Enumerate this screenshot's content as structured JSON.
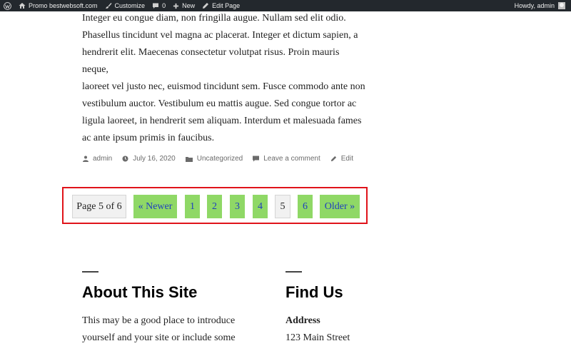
{
  "adminbar": {
    "site_name": "Promo bestwebsoft.com",
    "customize": "Customize",
    "comments_count": "0",
    "new_label": "New",
    "edit_page": "Edit Page",
    "howdy": "Howdy, admin",
    "icons": [
      "wordpress-icon",
      "home-icon",
      "brush-icon",
      "comment-icon",
      "plus-icon",
      "pencil-icon",
      "avatar"
    ]
  },
  "article": {
    "lines": [
      "Integer eu congue diam, non fringilla augue. Nullam sed elit odio.",
      "Phasellus tincidunt vel magna ac placerat. Integer et dictum sapien, a",
      "hendrerit elit. Maecenas consectetur volutpat risus. Proin mauris neque,",
      "laoreet vel justo nec, euismod tincidunt sem. Fusce commodo ante non",
      "vestibulum auctor. Vestibulum eu mattis augue. Sed congue tortor ac",
      "ligula laoreet, in hendrerit sem aliquam. Interdum et malesuada fames",
      "ac ante ipsum primis in faucibus."
    ]
  },
  "meta": {
    "author": "admin",
    "date": "July 16, 2020",
    "category": "Uncategorized",
    "comment": "Leave a comment",
    "edit": "Edit"
  },
  "pagination": {
    "page_of": "Page 5 of 6",
    "newer": "« Newer",
    "p1": "1",
    "p2": "2",
    "p3": "3",
    "p4": "4",
    "current": "5",
    "p6": "6",
    "older": "Older »"
  },
  "footer": {
    "about_title": "About This Site",
    "about_lines": [
      "This may be a good place to introduce",
      "yourself and your site or include some"
    ],
    "find_title": "Find Us",
    "address_label": "Address",
    "address_line1": "123 Main Street"
  },
  "colors": {
    "adminbar_bg": "#23282d",
    "pagination_link_bg": "#8fd866",
    "pagination_link_text": "#1f3fbf",
    "highlight_border": "#e0131a"
  }
}
